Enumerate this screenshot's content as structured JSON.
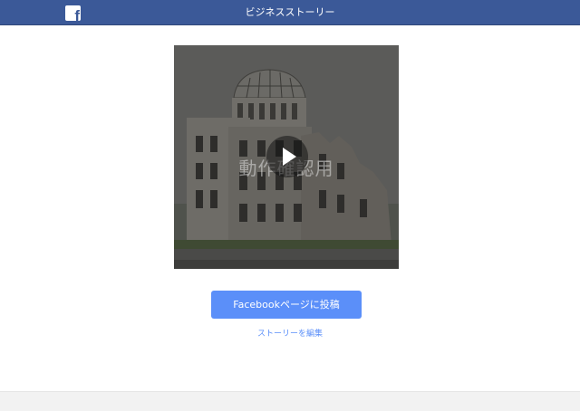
{
  "header": {
    "title": "ビジネスストーリー",
    "logo_letter": "f",
    "bg_color": "#3b5998"
  },
  "video": {
    "watermark": "動作確認用",
    "play_icon": "play-icon"
  },
  "actions": {
    "post_label": "Facebookページに投稿",
    "edit_label": "ストーリーを編集",
    "accent_color": "#5b8ff9"
  }
}
